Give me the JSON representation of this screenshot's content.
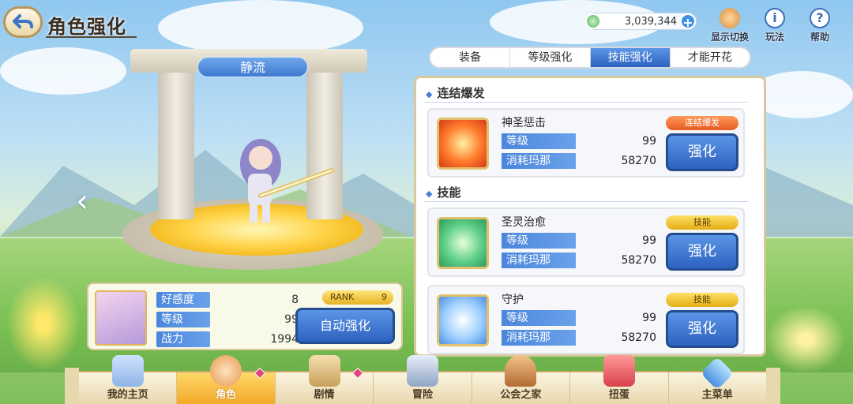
{
  "header": {
    "title": "角色强化",
    "currency": "3,039,344",
    "icons": [
      {
        "name": "display-switch",
        "label": "显示切换",
        "icon": "character-swap-icon"
      },
      {
        "name": "how-to-play",
        "label": "玩法",
        "icon": "info-icon"
      },
      {
        "name": "help",
        "label": "帮助",
        "icon": "question-icon"
      }
    ]
  },
  "character": {
    "name": "静流"
  },
  "stats": {
    "affection_label": "好感度",
    "affection": "8",
    "level_label": "等级",
    "level": "99",
    "power_label": "战力",
    "power": "1994",
    "rank_label": "RANK",
    "rank": "9",
    "auto_label": "自动强化"
  },
  "tabs": [
    {
      "label": "装备",
      "active": false
    },
    {
      "label": "等级强化",
      "active": false
    },
    {
      "label": "技能强化",
      "active": true
    },
    {
      "label": "才能开花",
      "active": false
    }
  ],
  "sections": {
    "burst": "连结爆发",
    "skills": "技能"
  },
  "skills": [
    {
      "name": "神圣惩击",
      "level_label": "等级",
      "level": "99",
      "cost_label": "消耗玛那",
      "cost": "58270",
      "badge": "连结爆发",
      "button": "强化"
    },
    {
      "name": "圣灵治愈",
      "level_label": "等级",
      "level": "99",
      "cost_label": "消耗玛那",
      "cost": "58270",
      "badge": "技能",
      "button": "强化"
    },
    {
      "name": "守护",
      "level_label": "等级",
      "level": "99",
      "cost_label": "消耗玛那",
      "cost": "58270",
      "badge": "技能",
      "button": "强化"
    }
  ],
  "nav": [
    {
      "label": "我的主页",
      "active": false
    },
    {
      "label": "角色",
      "active": true
    },
    {
      "label": "剧情",
      "active": false
    },
    {
      "label": "冒险",
      "active": false
    },
    {
      "label": "公会之家",
      "active": false
    },
    {
      "label": "扭蛋",
      "active": false
    },
    {
      "label": "主菜单",
      "active": false
    }
  ],
  "colors": {
    "accent_blue": "#2d62c0",
    "gold": "#e4ad16",
    "burst_red": "#e65a23"
  }
}
